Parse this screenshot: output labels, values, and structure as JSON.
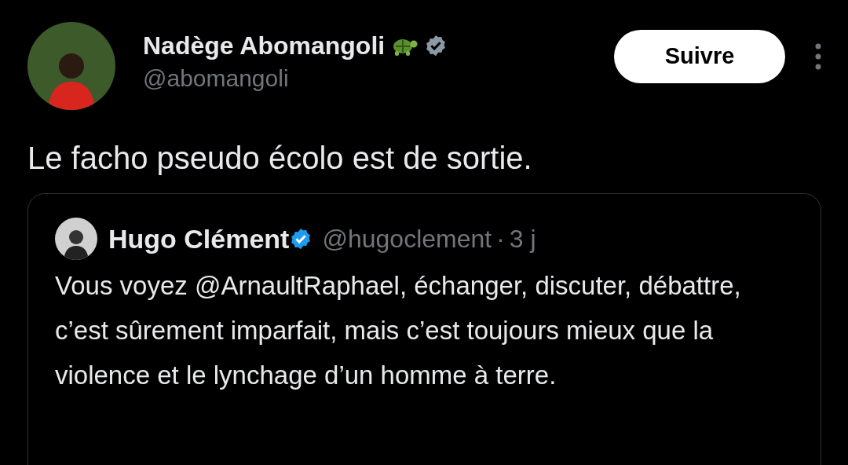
{
  "author": {
    "name": "Nadège Abomangoli",
    "handle": "@abomangoli",
    "verified": true
  },
  "follow_button": {
    "label": "Suivre"
  },
  "tweet_text": "Le facho pseudo écolo est de sortie.",
  "quoted_tweet": {
    "name": "Hugo Clément",
    "verified": true,
    "handle": "@hugoclement",
    "separator": "·",
    "time": "3 j",
    "text": "Vous voyez @ArnaultRaphael, échanger, discuter, débattre, c’est sûrement imparfait, mais c’est toujours mieux que la violence et le lynchage d’un homme à terre."
  }
}
